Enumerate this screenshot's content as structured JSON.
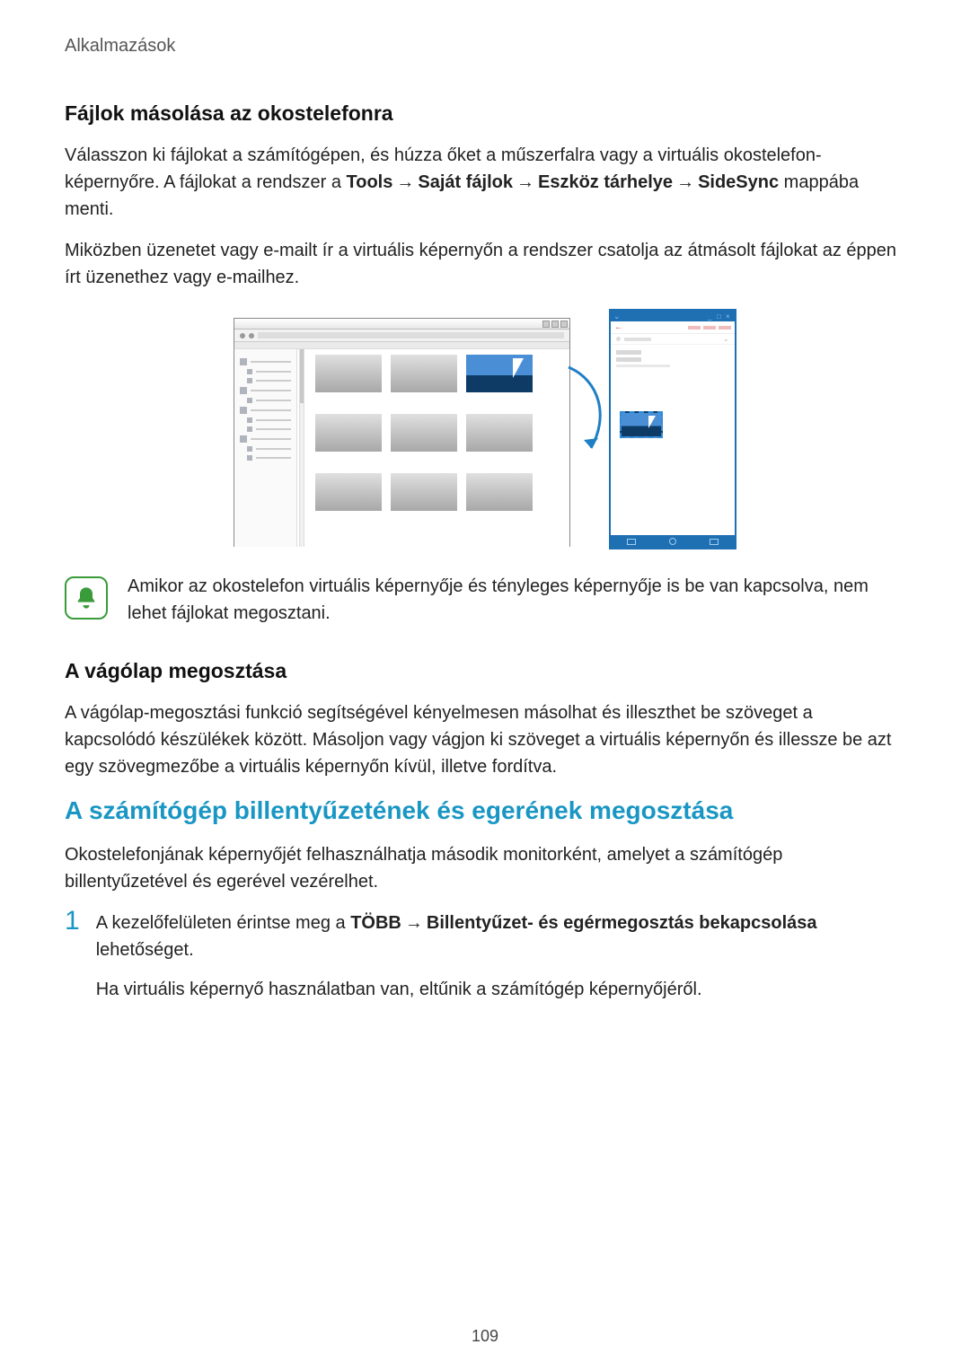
{
  "header": "Alkalmazások",
  "section1": {
    "title": "Fájlok másolása az okostelefonra",
    "p1_a": "Válasszon ki fájlokat a számítógépen, és húzza őket a műszerfalra vagy a virtuális okostelefon-képernyőre. A fájlokat a rendszer a ",
    "path_tools": "Tools",
    "path_myfiles": "Saját fájlok",
    "path_device": "Eszköz tárhelye",
    "path_sidesync": "SideSync",
    "p1_b": " mappába menti.",
    "p2": "Miközben üzenetet vagy e-mailt ír a virtuális képernyőn a rendszer csatolja az átmásolt fájlokat az éppen írt üzenethez vagy e-mailhez."
  },
  "note": {
    "text": "Amikor az okostelefon virtuális képernyője és tényleges képernyője is be van kapcsolva, nem lehet fájlokat megosztani."
  },
  "section2": {
    "title": "A vágólap megosztása",
    "p1": "A vágólap-megosztási funkció segítségével kényelmesen másolhat és illeszthet be szöveget a kapcsolódó készülékek között. Másoljon vagy vágjon ki szöveget a virtuális képernyőn és illessze be azt egy szövegmezőbe a virtuális képernyőn kívül, illetve fordítva."
  },
  "section3": {
    "title": "A számítógép billentyűzetének és egerének megosztása",
    "p1": "Okostelefonjának képernyőjét felhasználhatja második monitorként, amelyet a számítógép billentyűzetével és egerével vezérelhet.",
    "step1": {
      "num": "1",
      "a": "A kezelőfelületen érintse meg a ",
      "more": "TÖBB",
      "opt": "Billentyűzet- és egérmegosztás bekapcsolása",
      "b": " lehetőséget.",
      "p2": "Ha virtuális képernyő használatban van, eltűnik a számítógép képernyőjéről."
    }
  },
  "arrow": "→",
  "page_number": "109"
}
